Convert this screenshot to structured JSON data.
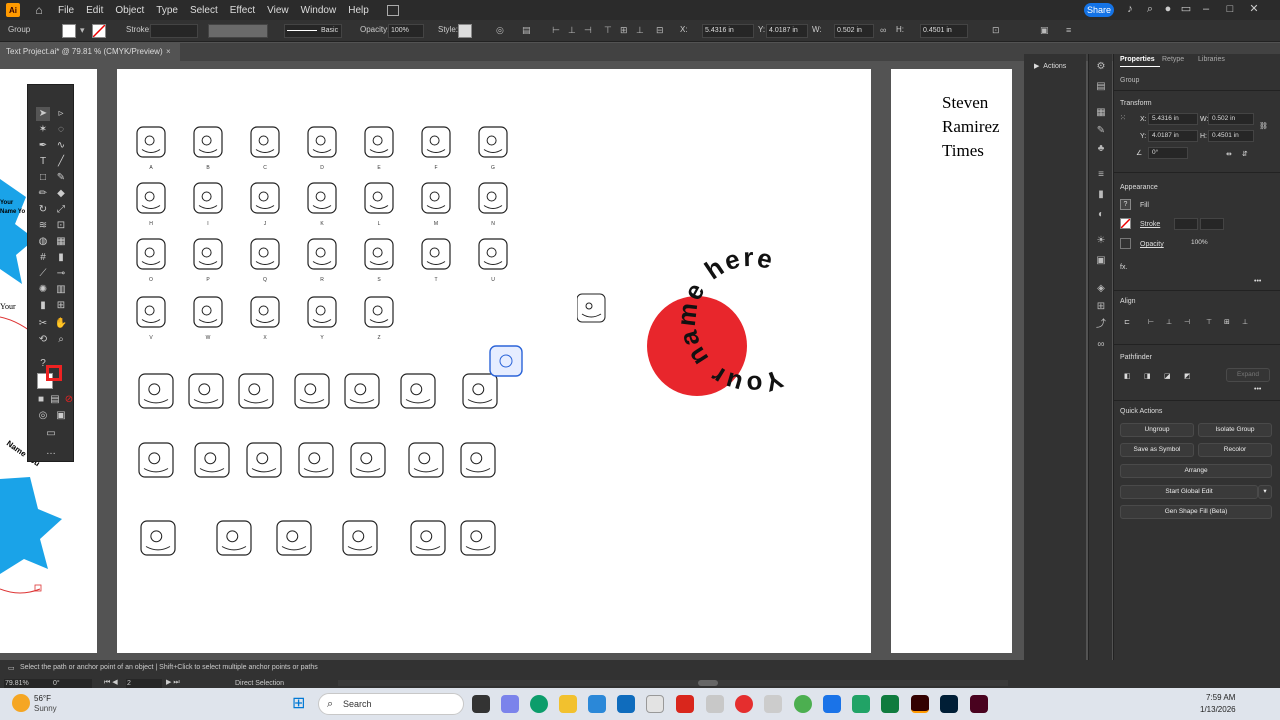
{
  "menu": {
    "logo": "Ai",
    "items": [
      "File",
      "Edit",
      "Object",
      "Type",
      "Select",
      "Effect",
      "View",
      "Window",
      "Help"
    ],
    "share_label": "Share"
  },
  "control": {
    "selection": "Group",
    "stroke_label": "Stroke:",
    "stroke_profile": "Basic",
    "opacity_label": "Opacity:",
    "opacity_value": "100%",
    "style_label": "Style:",
    "x_label": "X:",
    "x_value": "5.4316 in",
    "y_label": "Y:",
    "y_value": "4.0187 in",
    "w_label": "W:",
    "w_value": "0.502 in",
    "h_label": "H:",
    "h_value": "0.4501 in"
  },
  "document": {
    "tab_title": "Text Project.ai* @ 79.81 % (CMYK/Preview)"
  },
  "artwork": {
    "text_block": [
      "Steven",
      "Ramirez",
      "Times"
    ],
    "curved_text": "Your name here",
    "circle_color": "#e8262c",
    "left_text_1": "Your",
    "left_text_2": "Your Name Yo",
    "left_text_3": "Name You",
    "glyph_rows": [
      [
        "A",
        "B",
        "C",
        "D",
        "E",
        "F",
        "G"
      ],
      [
        "H",
        "I",
        "J",
        "K",
        "L",
        "M",
        "N"
      ],
      [
        "O",
        "P",
        "Q",
        "R",
        "S",
        "T",
        "U"
      ],
      [
        "V",
        "W",
        "X",
        "Y",
        "Z"
      ]
    ]
  },
  "panels": {
    "actions_label": "Actions",
    "tabs": [
      "Properties",
      "Retype",
      "Libraries"
    ],
    "group_label": "Group",
    "transform_label": "Transform",
    "x_label": "X:",
    "x_value": "5.4316 in",
    "w_label": "W:",
    "w_value": "0.502 in",
    "y_label": "Y:",
    "y_value": "4.0187 in",
    "h_label": "H:",
    "h_value": "0.4501 in",
    "angle_value": "0°",
    "appearance_label": "Appearance",
    "fill_label": "Fill",
    "stroke_label": "Stroke",
    "opacity_label": "Opacity",
    "opacity_value": "100%",
    "align_label": "Align",
    "pathfinder_label": "Pathfinder",
    "expand_label": "Expand",
    "quick_actions_label": "Quick Actions",
    "ungroup": "Ungroup",
    "isolate_group": "Isolate Group",
    "save_as_symbol": "Save as Symbol",
    "recolor": "Recolor",
    "arrange": "Arrange",
    "start_global_edit": "Start Global Edit",
    "gen_shape_fill": "Gen Shape Fill (Beta)"
  },
  "status": {
    "hint": "Select the path or anchor point of an object  |  Shift+Click to select multiple anchor points or paths",
    "zoom": "79.81%",
    "rotation": "0°",
    "artboard": "2",
    "mode": "Direct Selection"
  },
  "taskbar": {
    "weather_temp": "56°F",
    "weather_desc": "Sunny",
    "search_placeholder": "Search",
    "time": "7:59 AM",
    "date": "1/13/2026"
  },
  "colors": {
    "accent": "#1473e6",
    "brand": "#ff9a00",
    "selection": "#2b64d8"
  }
}
